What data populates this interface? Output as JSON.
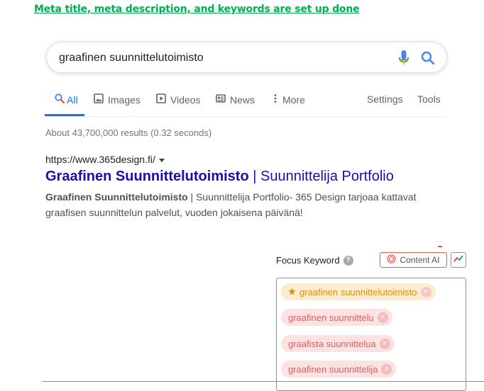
{
  "heading": "Meta title, meta description, and keywords are set up done",
  "search": {
    "query": "graafinen suunnittelutoimisto",
    "mic_icon": "mic-icon",
    "search_icon": "search-icon"
  },
  "tabs": [
    {
      "label": "All",
      "icon": "search-icon",
      "active": true
    },
    {
      "label": "Images",
      "icon": "image-icon"
    },
    {
      "label": "Videos",
      "icon": "video-icon"
    },
    {
      "label": "News",
      "icon": "news-icon"
    },
    {
      "label": "More",
      "icon": "more-vert-icon"
    }
  ],
  "tools": {
    "settings": "Settings",
    "tools": "Tools"
  },
  "stats": "About 43,700,000 results (0.32 seconds)",
  "result": {
    "url": "https://www.365design.fi/",
    "title_bold": "Graafinen Suunnittelutoimisto",
    "title_rest": " | Suunnittelija Portfolio",
    "snippet_bold": "Graafinen Suunnittelutoimisto",
    "snippet_rest": " | Suunnittelija Portfolio- 365 Design tarjoaa kattavat graafisen suunnittelun palvelut, vuoden jokaisena päivänä!"
  },
  "seo": {
    "focus_label": "Focus Keyword",
    "content_ai": "Content AI",
    "keywords": [
      "graafinen suunnittelutoimisto",
      "graafinen suunnittelu",
      "graafista suunnittelua",
      "graafinen suunnittelija"
    ]
  },
  "colors": {
    "heading": "#00b050",
    "link": "#1a0dab",
    "active_tab": "#1a73e8",
    "primary_keyword": "#e28f07",
    "secondary_keyword": "#e35d5d"
  }
}
